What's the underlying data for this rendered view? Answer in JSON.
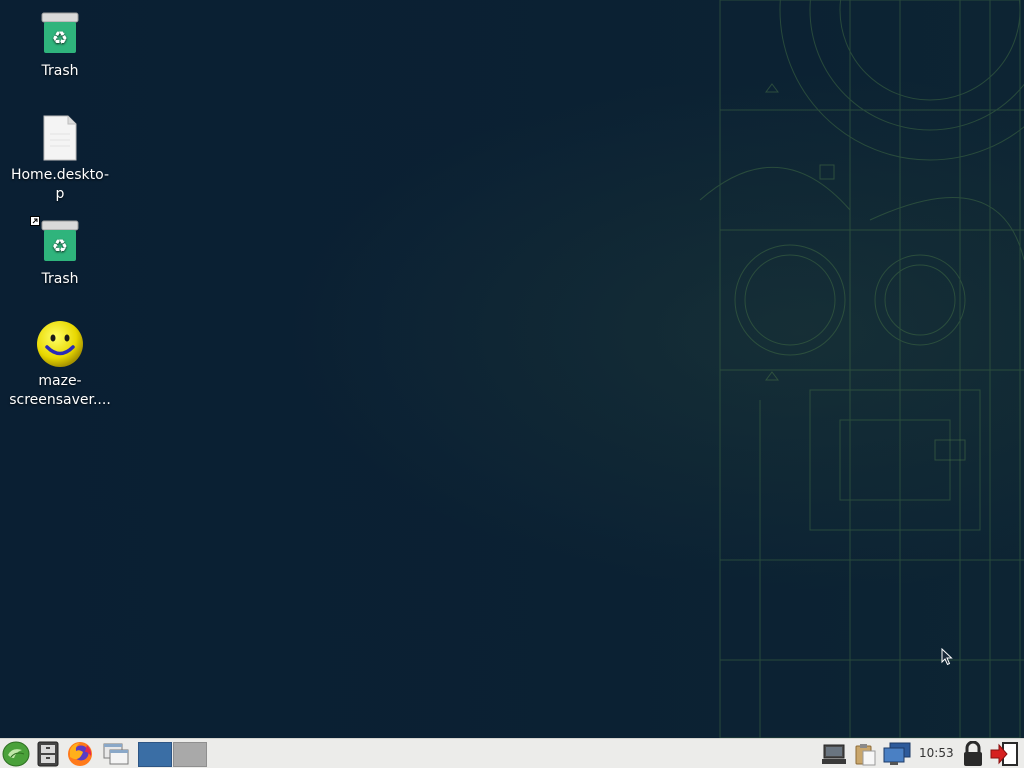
{
  "desktop": {
    "icons": [
      {
        "label": "Trash",
        "icon": "trash-icon"
      },
      {
        "label": "Home.deskto-\np",
        "icon": "document-icon"
      },
      {
        "label": "Trash",
        "icon": "trash-icon"
      },
      {
        "label": "maze-\nscreensaver....",
        "icon": "smiley-icon"
      }
    ]
  },
  "taskbar": {
    "launchers": [
      "start-menu-icon",
      "file-manager-icon",
      "firefox-icon",
      "show-desktop-icon"
    ],
    "workspaces": [
      {
        "color": "#3a6ea5",
        "active": true
      },
      {
        "color": "#a9a9a9",
        "active": false
      }
    ],
    "tray": [
      "network-icon",
      "clipboard-icon",
      "display-icon"
    ],
    "clock": "10:53",
    "actions": [
      "lock-icon",
      "logout-icon"
    ]
  },
  "colors": {
    "desktop_bg": "#0a1f33",
    "taskbar_bg": "#ececea",
    "trash_green": "#2fb47c"
  }
}
